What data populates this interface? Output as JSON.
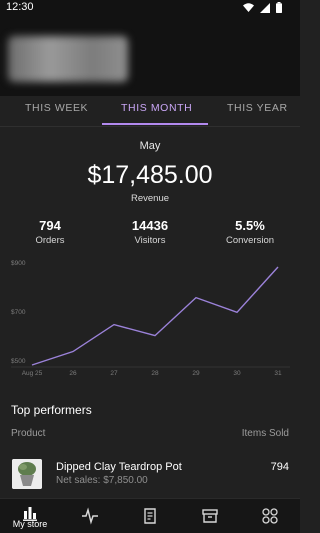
{
  "status_bar": {
    "time": "12:30"
  },
  "tabs": [
    {
      "label": "THIS WEEK",
      "active": false
    },
    {
      "label": "THIS MONTH",
      "active": true
    },
    {
      "label": "THIS YEAR",
      "active": false
    }
  ],
  "summary": {
    "period": "May",
    "revenue": "$17,485.00",
    "revenue_label": "Revenue",
    "stats": [
      {
        "value": "794",
        "label": "Orders"
      },
      {
        "value": "14436",
        "label": "Visitors"
      },
      {
        "value": "5.5%",
        "label": "Conversion"
      }
    ]
  },
  "chart_data": {
    "type": "line",
    "x": [
      "Aug 25",
      "26",
      "27",
      "28",
      "29",
      "30",
      "31"
    ],
    "series": [
      {
        "values": [
          500,
          555,
          665,
          620,
          775,
          715,
          900
        ]
      }
    ],
    "yticks": [
      "$900",
      "$700",
      "$500"
    ],
    "ylim": [
      500,
      900
    ],
    "grid": false,
    "colors": {
      "line": "#9b82d9",
      "axis": "#3a3a3a"
    }
  },
  "top_performers": {
    "title": "Top performers",
    "col_product": "Product",
    "col_items_sold": "Items Sold",
    "products": [
      {
        "name": "Dipped Clay Teardrop Pot",
        "net_sales": "Net sales: $7,850.00",
        "items_sold": "794"
      }
    ]
  },
  "bottom_nav": [
    {
      "label": "My store",
      "icon": "bar-chart-icon",
      "active": true
    },
    {
      "label": "",
      "icon": "activity-pulse-icon",
      "active": false
    },
    {
      "label": "",
      "icon": "orders-document-icon",
      "active": false
    },
    {
      "label": "",
      "icon": "products-archive-icon",
      "active": false
    },
    {
      "label": "",
      "icon": "more-grid-icon",
      "active": false
    }
  ],
  "colors": {
    "accent": "#b289ee",
    "background": "#212121",
    "header": "#121212"
  }
}
